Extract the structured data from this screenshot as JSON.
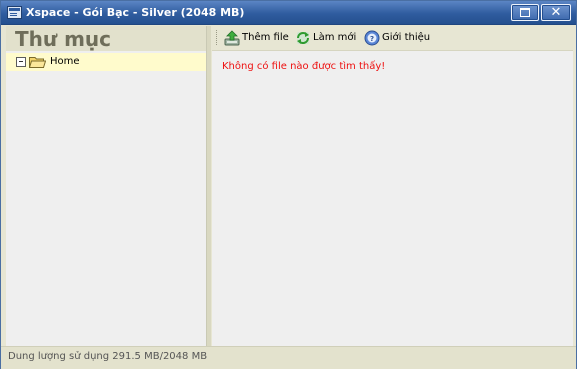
{
  "window": {
    "title": "Xspace - Gói Bạc - Silver (2048 MB)",
    "close_label": "✕"
  },
  "sidebar": {
    "title": "Thư mục",
    "tree": [
      {
        "label": "Home",
        "expanded": true,
        "icon": "folder-open-icon"
      }
    ]
  },
  "toolbar": {
    "buttons": [
      {
        "label": "Thêm file",
        "icon": "upload-icon"
      },
      {
        "label": "Làm mới",
        "icon": "refresh-icon"
      },
      {
        "label": "Giới thiệu",
        "icon": "info-icon"
      }
    ]
  },
  "content": {
    "empty_message": "Không có file nào được tìm thấy!"
  },
  "status": {
    "text": "Dung lượng sử dụng 291.5 MB/2048 MB"
  },
  "colors": {
    "titlebar": "#2f5c9f",
    "panel_bg": "#efefef",
    "chrome_bg": "#e7e6d3",
    "selected_row": "#fffbcc",
    "error_text": "#ee1111"
  }
}
